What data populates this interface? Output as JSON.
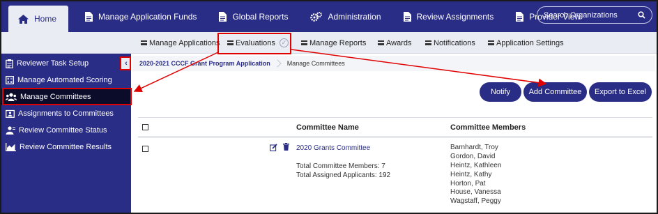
{
  "topnav": {
    "items": [
      {
        "label": "Home",
        "icon": "home-icon"
      },
      {
        "label": "Manage Application Funds",
        "icon": "document-icon"
      },
      {
        "label": "Global Reports",
        "icon": "document-icon"
      },
      {
        "label": "Administration",
        "icon": "gears-icon"
      },
      {
        "label": "Review Assignments",
        "icon": "document-icon"
      },
      {
        "label": "Provider View",
        "icon": "document-icon"
      }
    ],
    "search_label": "Search Organizations"
  },
  "subnav": {
    "items": [
      {
        "label": "Manage Applications"
      },
      {
        "label": "Evaluations"
      },
      {
        "label": "Manage Reports"
      },
      {
        "label": "Awards"
      },
      {
        "label": "Notifications"
      },
      {
        "label": "Application Settings"
      }
    ]
  },
  "sidebar": {
    "items": [
      {
        "label": "Reviewer Task Setup",
        "icon": "clipboard-icon"
      },
      {
        "label": "Manage Automated Scoring",
        "icon": "calculator-icon"
      },
      {
        "label": "Manage Committees",
        "icon": "users-icon"
      },
      {
        "label": "Assignments to Committees",
        "icon": "assignment-icon"
      },
      {
        "label": "Review Committee Status",
        "icon": "person-status-icon"
      },
      {
        "label": "Review Committee Results",
        "icon": "chart-icon"
      }
    ],
    "collapse_glyph": "‹"
  },
  "breadcrumb": {
    "program": "2020-2021 CCCF Grant Program Application",
    "current": "Manage Committees"
  },
  "actions": {
    "notify": "Notify",
    "add_committee": "Add Committee",
    "export": "Export to Excel"
  },
  "table": {
    "columns": [
      "Committee Name",
      "Committee Members"
    ],
    "rows": [
      {
        "name": "2020 Grants Committee",
        "total_members": "Total Committee Members: 7",
        "total_applicants": "Total Assigned Applicants: 192",
        "members": [
          "Barnhardt, Troy",
          "Gordon, David",
          "Heintz, Kathleen",
          "Heintz, Kathy",
          "Horton, Pat",
          "House, Vanessa",
          "Wagstaff, Peggy"
        ]
      }
    ]
  },
  "colors": {
    "brand_navy": "#2a2d85",
    "annotation_red": "#e00000",
    "active_sidebar": "#0b0c2a"
  }
}
